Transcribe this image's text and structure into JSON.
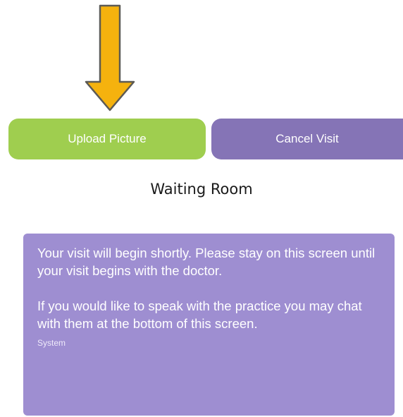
{
  "annotation": {
    "arrow_color": "#f5b20e",
    "arrow_outline_color": "#5c5a55"
  },
  "actions": {
    "upload_label": "Upload Picture",
    "upload_color": "#9fce4f",
    "cancel_label": "Cancel Visit",
    "cancel_color": "#8574b6"
  },
  "screen": {
    "title": "Waiting Room"
  },
  "message": {
    "paragraph_1": "Your visit will begin shortly. Please stay on this screen until your visit begins with the doctor.",
    "paragraph_2": "If you would like to speak with the practice you may chat with them at the bottom of this screen.",
    "sender": "System",
    "bubble_color": "#9e8ed1"
  }
}
